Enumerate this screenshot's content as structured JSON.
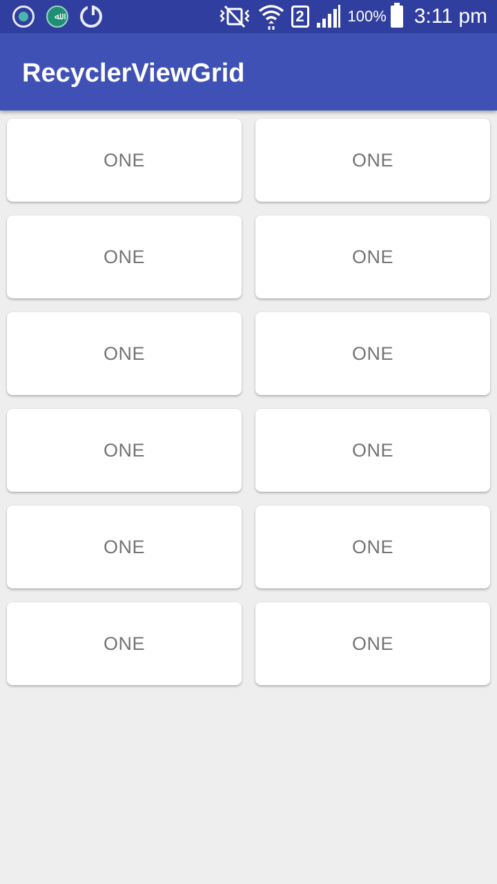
{
  "status_bar": {
    "notifications": [
      "chat-notification-icon",
      "app-notification-icon",
      "sync-icon"
    ],
    "app_notification_glyph": "ﷲ",
    "sim_slot": "2",
    "battery_percent": "100%",
    "time": "3:11 pm",
    "icons": [
      "vibrate-icon",
      "wifi-icon",
      "signal-icon",
      "battery-icon"
    ]
  },
  "app_bar": {
    "title": "RecyclerViewGrid",
    "color": "#3F51B5"
  },
  "grid": {
    "columns": 2,
    "items": [
      {
        "label": "ONE"
      },
      {
        "label": "ONE"
      },
      {
        "label": "ONE"
      },
      {
        "label": "ONE"
      },
      {
        "label": "ONE"
      },
      {
        "label": "ONE"
      },
      {
        "label": "ONE"
      },
      {
        "label": "ONE"
      },
      {
        "label": "ONE"
      },
      {
        "label": "ONE"
      },
      {
        "label": "ONE"
      },
      {
        "label": "ONE"
      }
    ]
  }
}
